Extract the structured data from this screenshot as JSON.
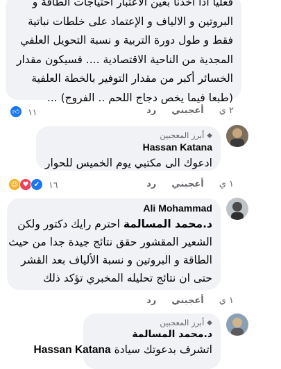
{
  "comment1": {
    "lines": [
      "فعليا اذا أخذنا بعين الاعتبار احتياجات الطاقة و",
      "البروتين و الالياف و الإعتماد على خلطات نباتية",
      "فقط و طول دورة التربية و نسبة التحويل العلفي",
      "المجدية من الناحية الاقتصادية .... فسيكون مقدار",
      "الخسائر أكبر من مقدار التوفير بالخطة العلفية",
      "(طبعا فيما يخص دجاج اللحم .. الفروج) ..."
    ],
    "time": "٢ ي",
    "like_label": "أعجبني",
    "reply_label": "رد",
    "reaction_count": "١١"
  },
  "comment2": {
    "badge": "أبرز المعجبين",
    "author": "Hassan Katana",
    "text": "ادعوك الى مكتبي يوم الخميس للحوار",
    "time": "١ ي",
    "like_label": "أعجبني",
    "reply_label": "رد",
    "reaction_count": "١٦"
  },
  "comment3": {
    "author": "Ali Mohammad",
    "lines": [
      "د.محمد المسالمة احترم رايك دكتور ولكن",
      "الشعير المقشور حقق نتائج جيدة جدا من حيث",
      "الطاقة و البروتين و نسبة الألياف بعد القشر",
      "حتى ان نتائج تحليله المخبري تؤكد ذلك"
    ],
    "mention": "د.محمد المسالمة",
    "time": "١ ي",
    "like_label": "أعجبني",
    "reply_label": "رد"
  },
  "comment4": {
    "badge": "أبرز المعجبين",
    "author": "د.محمد المسالمة",
    "text_prefix": "اتشرف بدعوتك سيادة",
    "mention": "Hassan Katana"
  },
  "colors": {
    "bubble": "#f0f2f5",
    "meta": "#65676b",
    "like_blue": "#1877f2",
    "love_red": "#f33e58",
    "haha_yellow": "#f7b125"
  }
}
